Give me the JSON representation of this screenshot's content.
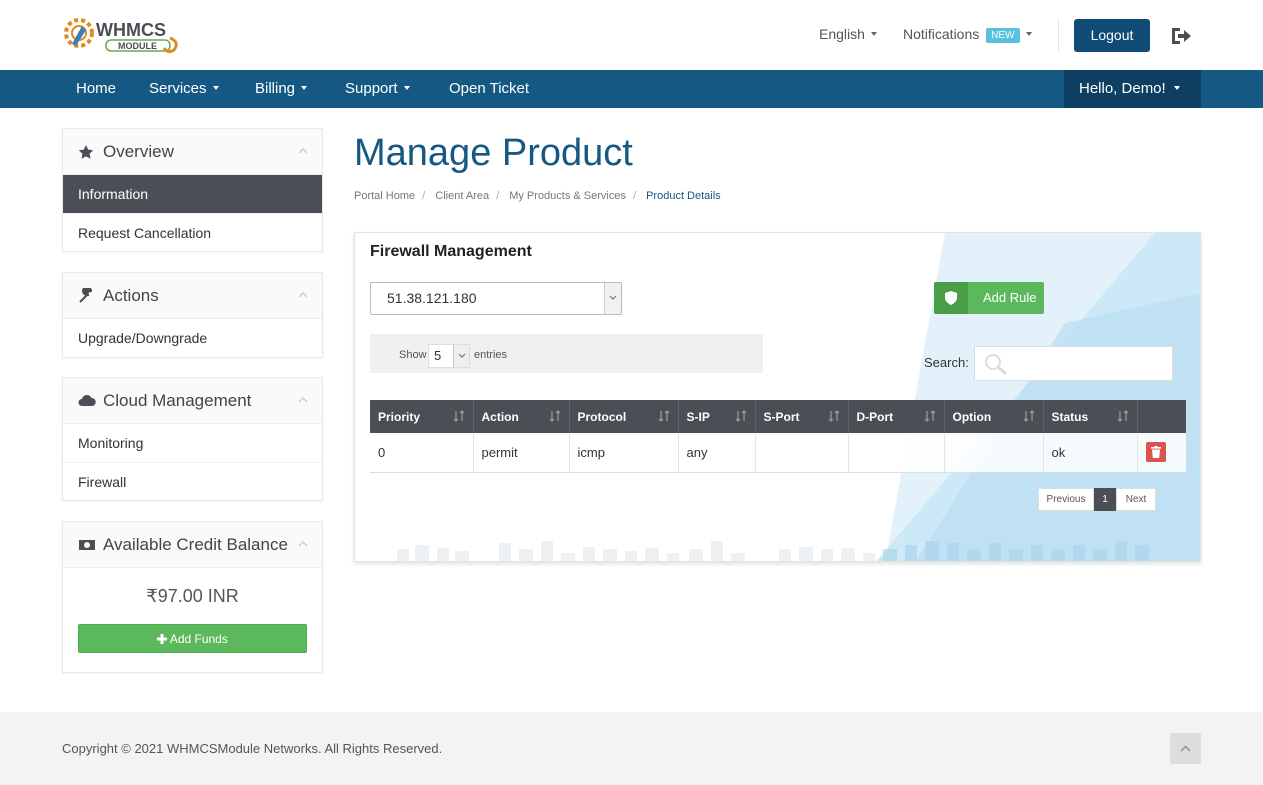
{
  "header": {
    "logo_text": "WHMCS MODULE",
    "language": "English",
    "notifications": "Notifications",
    "new_badge": "NEW",
    "logout": "Logout"
  },
  "nav": {
    "items": [
      "Home",
      "Services",
      "Billing",
      "Support",
      "Open Ticket"
    ],
    "user": "Hello, Demo!"
  },
  "sidebar": {
    "overview": {
      "title": "Overview",
      "items": [
        "Information",
        "Request Cancellation"
      ]
    },
    "actions": {
      "title": "Actions",
      "items": [
        "Upgrade/Downgrade"
      ]
    },
    "cloud": {
      "title": "Cloud Management",
      "items": [
        "Monitoring",
        "Firewall"
      ]
    },
    "credit": {
      "title": "Available Credit Balance",
      "amount": "₹97.00 INR",
      "add_funds": "Add Funds"
    }
  },
  "main": {
    "title": "Manage Product",
    "breadcrumb": [
      "Portal Home",
      "Client Area",
      "My Products & Services",
      "Product Details"
    ]
  },
  "firewall": {
    "title": "Firewall Management",
    "ip": "51.38.121.180",
    "add_rule": "Add Rule",
    "show": "Show",
    "length": "5",
    "entries": "entries",
    "search_label": "Search:",
    "columns": [
      "Priority",
      "Action",
      "Protocol",
      "S-IP",
      "S-Port",
      "D-Port",
      "Option",
      "Status"
    ],
    "rows": [
      {
        "priority": "0",
        "action": "permit",
        "protocol": "icmp",
        "sip": "any",
        "sport": "",
        "dport": "",
        "option": "",
        "status": "ok"
      }
    ],
    "pager": {
      "prev": "Previous",
      "page": "1",
      "next": "Next"
    }
  },
  "footer": {
    "copyright": "Copyright © 2021 WHMCSModule Networks. All Rights Reserved."
  },
  "colors": {
    "primary": "#155883",
    "nav_dark": "#0e3f62",
    "success": "#5cb85c",
    "danger": "#d9534f",
    "sidebar_active": "#4a4f55"
  }
}
